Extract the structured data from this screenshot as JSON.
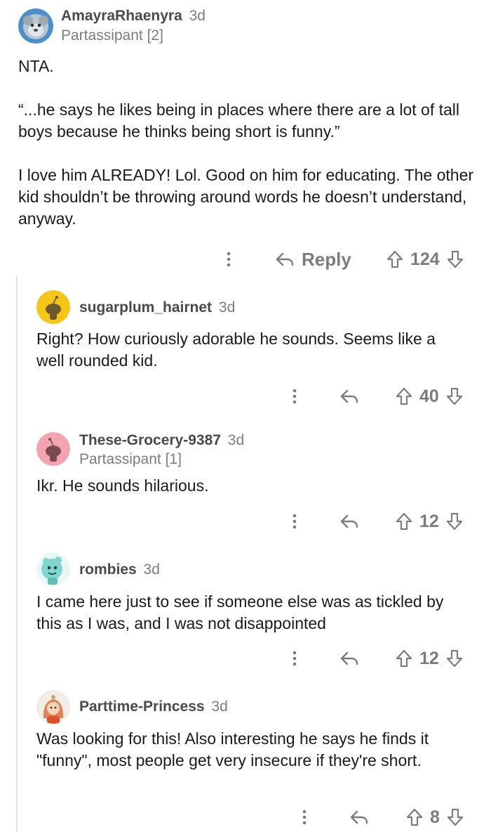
{
  "comments": [
    {
      "username": "AmayraRhaenyra",
      "age": "3d",
      "flair": "Partassipant [2]",
      "paragraphs": [
        "NTA.",
        "“...he says he likes being in places where there are a lot of tall boys because he thinks being short is funny.”",
        "I love him ALREADY! Lol. Good on him for educating. The other kid shouldn’t be throwing around words he doesn’t understand, anyway."
      ],
      "reply_label": "Reply",
      "votes": "124"
    },
    {
      "username": "sugarplum_hairnet",
      "age": "3d",
      "paragraphs": [
        "Right? How curiously adorable he sounds. Seems like a well rounded kid."
      ],
      "votes": "40"
    },
    {
      "username": "These-Grocery-9387",
      "age": "3d",
      "flair": "Partassipant [1]",
      "paragraphs": [
        "Ikr. He sounds hilarious."
      ],
      "votes": "12"
    },
    {
      "username": "rombies",
      "age": "3d",
      "paragraphs": [
        "I came here just to see if someone else was as tickled by this as I was, and I was not disappointed"
      ],
      "votes": "12"
    },
    {
      "username": "Parttime-Princess",
      "age": "3d",
      "paragraphs": [
        "Was looking for this! Also interesting he says he finds it \"funny\", most people get very insecure if they're short."
      ],
      "votes": "8"
    }
  ],
  "colors": {
    "text": "#1a1a1b",
    "meta": "#7c7c7c",
    "avatar_yellow": "#f5c518",
    "avatar_pink": "#f4a4b0",
    "avatar_teal": "#7fd6cf"
  },
  "icons": [
    "more-options-icon",
    "reply-arrow-icon",
    "upvote-icon",
    "downvote-icon"
  ]
}
